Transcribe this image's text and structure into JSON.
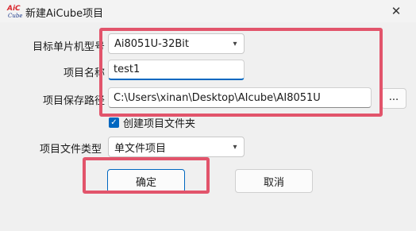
{
  "window": {
    "title": "新建AiCube项目",
    "logo_text": "AiCCube",
    "close_glyph": "✕"
  },
  "form": {
    "mcu_label": "目标单片机型号",
    "mcu_value": "Ai8051U-32Bit",
    "name_label": "项目名称",
    "name_value": "test1",
    "path_label": "项目保存路径",
    "path_value": "C:\\Users\\xinan\\Desktop\\AIcube\\AI8051U",
    "browse_label": "...",
    "create_folder_label": "创建项目文件夹",
    "create_folder_checked": true,
    "filetype_label": "项目文件类型",
    "filetype_value": "单文件项目"
  },
  "buttons": {
    "ok": "确定",
    "cancel": "取消"
  },
  "icons": {
    "dropdown": "chevron-down-icon",
    "checkbox": "check-icon"
  },
  "colors": {
    "highlight": "#e2546b",
    "accent": "#0067c0"
  }
}
